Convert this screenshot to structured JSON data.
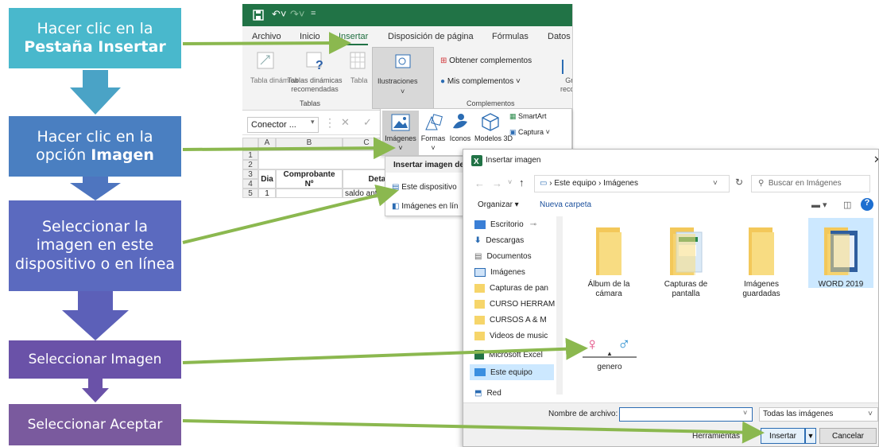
{
  "steps": [
    {
      "line1": "Hacer clic en la",
      "bold": "Pestaña Insertar",
      "color": "#49b8cc"
    },
    {
      "line1": "Hacer clic en la opción",
      "bold": "Imagen",
      "color": "#4a7fc1"
    },
    {
      "text": "Seleccionar la imagen  en este dispositivo o en línea",
      "color": "#5b6abf"
    },
    {
      "text": "Seleccionar Imagen",
      "color": "#6a52a8"
    },
    {
      "text": "Seleccionar Aceptar",
      "color": "#7a5a9e"
    }
  ],
  "excel": {
    "tabs": [
      "Archivo",
      "Inicio",
      "Insertar",
      "Disposición de página",
      "Fórmulas",
      "Datos"
    ],
    "active_tab": "Insertar",
    "ribbon": {
      "tabla_dinamica": "Tabla dinámica",
      "tablas_dinamicas_rec": "Tablas dinámicas recomendadas",
      "tabla": "Tabla",
      "tablas_group": "Tablas",
      "ilustraciones": "Ilustraciones",
      "obtener_complementos": "Obtener complementos",
      "mis_complementos": "Mis complementos",
      "complementos_group": "Complementos",
      "gr_reco": "Gr reco"
    },
    "namebox": "Conector ...",
    "cell_refs": "A   B   C",
    "rows": [
      "1",
      "2",
      "3",
      "4",
      "5"
    ],
    "table": {
      "dia": "Dia",
      "comprobante": "Comprobante",
      "numero": "Nº",
      "detalle": "Detal",
      "row5_dia": "1",
      "row5_det": "saldo ante"
    }
  },
  "illus_panel": {
    "imagenes": "Imágenes",
    "formas": "Formas",
    "iconos": "Iconos",
    "modelos": "Modelos 3D",
    "smartart": "SmartArt",
    "captura": "Captura"
  },
  "insert_menu": {
    "title": "Insertar imagen de",
    "device": "Este dispositivo",
    "online": "Imágenes en lín"
  },
  "dialog": {
    "title": "Insertar imagen",
    "path_a": "Este equipo",
    "path_b": "Imágenes",
    "search_placeholder": "Buscar en Imágenes",
    "organizar": "Organizar",
    "nueva_carpeta": "Nueva carpeta",
    "sidebar": [
      "Escritorio",
      "Descargas",
      "Documentos",
      "Imágenes",
      "Capturas de pan",
      "CURSO HERRAM",
      "CURSOS A & M",
      "Videos de music",
      "Microsoft Excel",
      "Este equipo",
      "Red"
    ],
    "files": [
      "Álbum de la cámara",
      "Capturas de pantalla",
      "Imágenes guardadas",
      "WORD 2019",
      "genero"
    ],
    "filename_label": "Nombre de archivo:",
    "filename_value": "",
    "filetype": "Todas las imágenes",
    "herramientas": "Herramientas",
    "insertar": "Insertar",
    "cancelar": "Cancelar"
  },
  "colors": {
    "excel_green": "#217346",
    "arrow_green": "#8bb84f",
    "folder": "#f6d56a",
    "selection": "#cce8ff"
  }
}
